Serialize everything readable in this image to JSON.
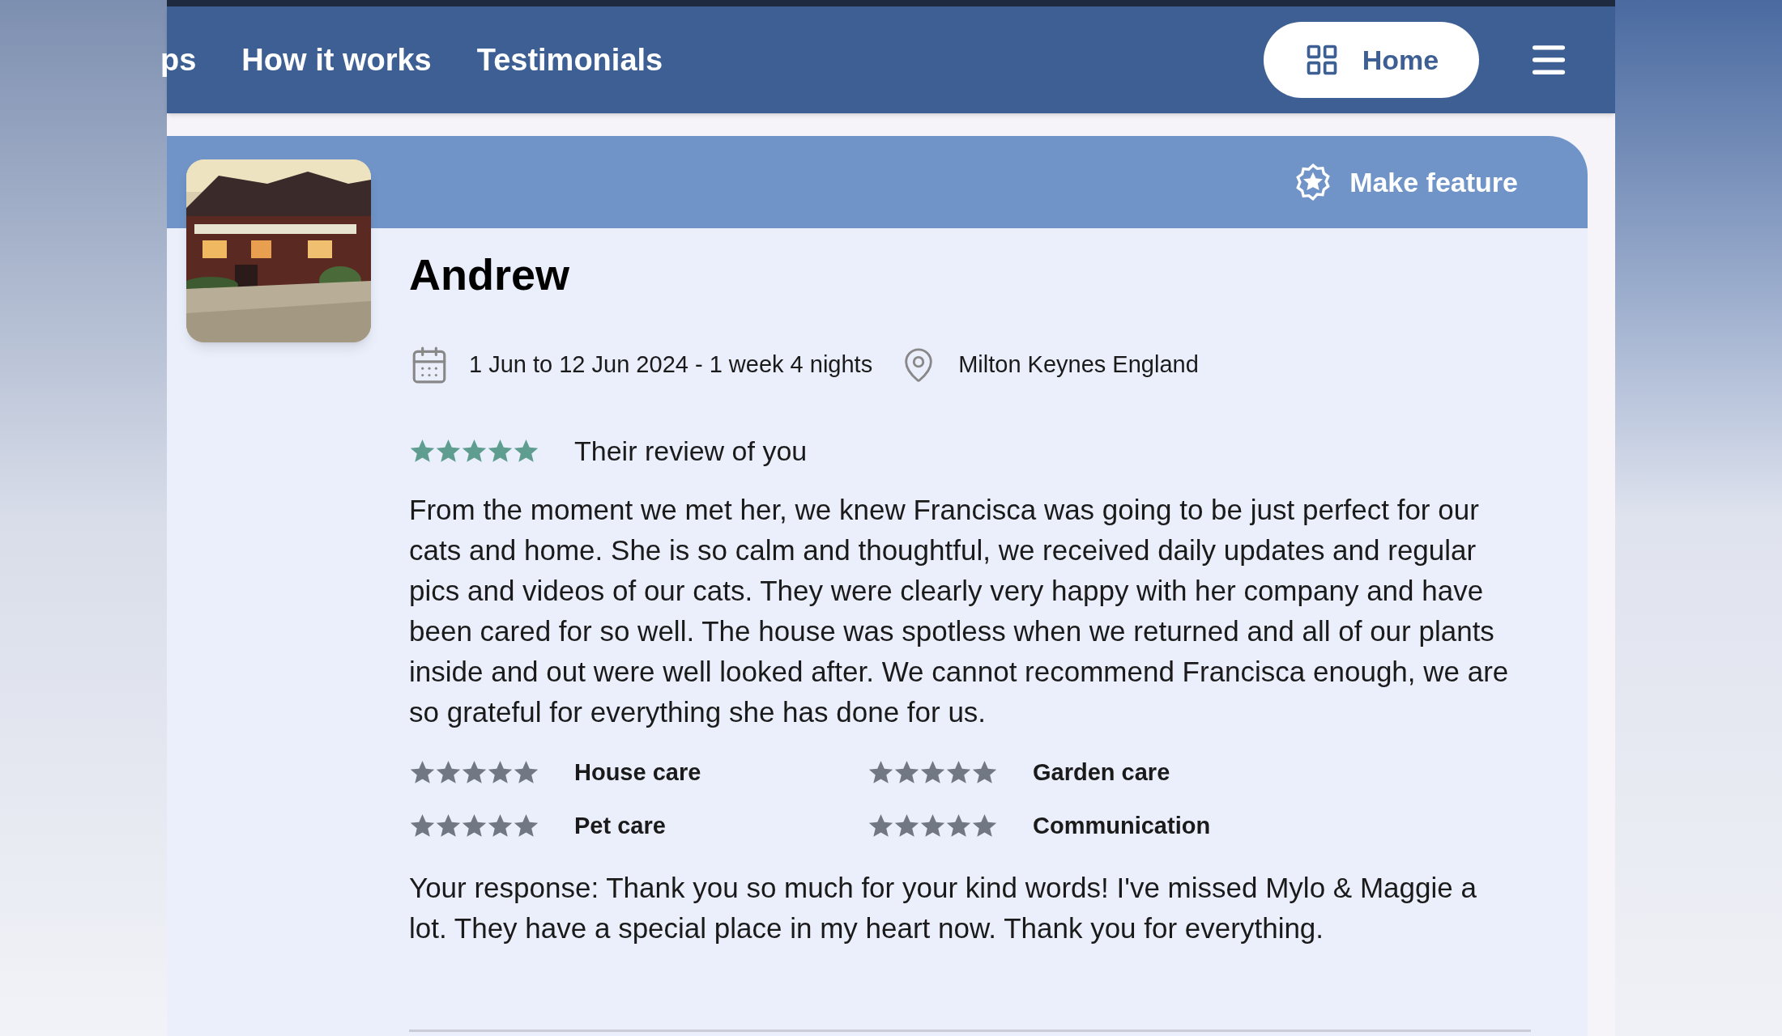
{
  "nav": {
    "links": [
      {
        "label": "ps"
      },
      {
        "label": "How it works"
      },
      {
        "label": "Testimonials"
      }
    ],
    "home_button": "Home"
  },
  "review": {
    "feature_button": "Make feature",
    "name": "Andrew",
    "dates": "1 Jun to 12 Jun 2024 - 1 week 4 nights",
    "location": "Milton Keynes England",
    "overall": {
      "stars": 5,
      "label": "Their review of you"
    },
    "text": "From the moment we met her, we knew Francisca was going to be just perfect for our cats and home. She is so calm and thoughtful, we received daily updates and regular pics and videos of our cats. They were clearly very happy with her company and have been cared for so well. The house was spotless when we returned and all of our plants inside and out were well looked after. We cannot recommend Francisca enough, we are so grateful for everything she has done for us.",
    "ratings": [
      {
        "label": "House care",
        "stars": 5
      },
      {
        "label": "Garden care",
        "stars": 5
      },
      {
        "label": "Pet care",
        "stars": 5
      },
      {
        "label": "Communication",
        "stars": 5
      }
    ],
    "response": "Your response: Thank you so much for your kind words! I've missed Mylo & Maggie a lot. They have a special place in my heart now. Thank you for everything."
  }
}
